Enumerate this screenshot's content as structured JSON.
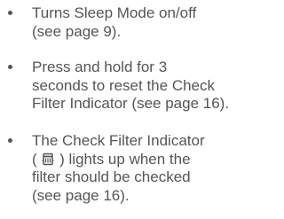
{
  "bullets": [
    {
      "lines": [
        "Turns Sleep Mode on/off",
        "(see page 9)."
      ]
    },
    {
      "lines": [
        "Press and hold for 3",
        "seconds to reset the Check",
        "Filter Indicator (see page 16)."
      ]
    },
    {
      "lines": [
        "The Check Filter Indicator",
        ") lights up when the",
        "filter should be checked",
        "(see page 16)."
      ],
      "icon_open_paren": "(",
      "icon": "check-filter-icon"
    }
  ]
}
